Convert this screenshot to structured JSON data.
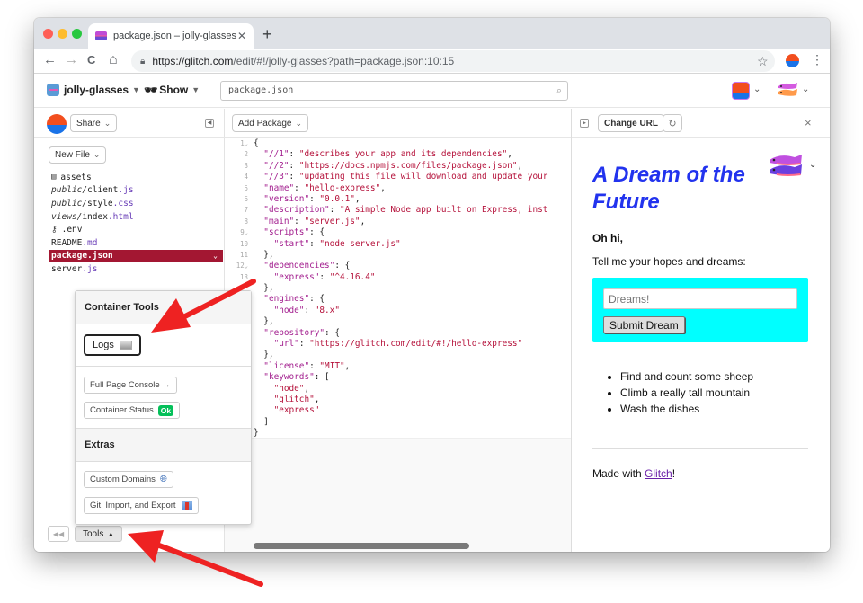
{
  "browser": {
    "tab_title": "package.json – jolly-glasses",
    "tab_close": "✕",
    "new_tab": "+",
    "url_host": "https://glitch.com",
    "url_path": "/edit/#!/jolly-glasses?path=package.json:10:15",
    "nav": {
      "back": "←",
      "forward": "→",
      "reload": "C",
      "home": "⌂"
    },
    "star": "☆",
    "menu": "⋮"
  },
  "header": {
    "project_name": "jolly-glasses",
    "show_label": "Show",
    "file_search_value": "package.json",
    "search_icon": "⌕"
  },
  "sidebar": {
    "share_label": "Share",
    "new_file_label": "New File",
    "files": [
      {
        "icon": "assets",
        "dir": "",
        "name": "assets",
        "ext": ""
      },
      {
        "dir": "public/",
        "name": "client",
        "ext": ".js"
      },
      {
        "dir": "public/",
        "name": "style",
        "ext": ".css"
      },
      {
        "dir": "views/",
        "name": "index",
        "ext": ".html"
      },
      {
        "icon": "key",
        "dir": "",
        "name": ".env",
        "ext": ""
      },
      {
        "dir": "",
        "name": "README",
        "ext": ".md"
      },
      {
        "dir": "",
        "name": "package.json",
        "ext": "",
        "active": true
      },
      {
        "dir": "",
        "name": "server",
        "ext": ".js"
      }
    ],
    "tools_label": "Tools",
    "tools_back_icon": "◀◀"
  },
  "tools_popover": {
    "container_tools_heading": "Container Tools",
    "logs_label": "Logs",
    "full_page_console_label": "Full Page Console →",
    "container_status_label": "Container Status",
    "container_status_badge": "Ok",
    "extras_heading": "Extras",
    "custom_domains_label": "Custom Domains",
    "git_import_export_label": "Git, Import, and Export",
    "status_color": "#05c05a"
  },
  "editor": {
    "add_package_label": "Add Package",
    "lines": [
      {
        "n": "1",
        "fold": true,
        "parts": [
          [
            "p",
            "{"
          ]
        ]
      },
      {
        "n": "2",
        "parts": [
          [
            "p",
            "  "
          ],
          [
            "k",
            "\"//1\""
          ],
          [
            "p",
            ": "
          ],
          [
            "s",
            "\"describes your app and its dependencies\""
          ],
          [
            "p",
            ","
          ]
        ]
      },
      {
        "n": "3",
        "parts": [
          [
            "p",
            "  "
          ],
          [
            "k",
            "\"//2\""
          ],
          [
            "p",
            ": "
          ],
          [
            "s",
            "\"https://docs.npmjs.com/files/package.json\""
          ],
          [
            "p",
            ","
          ]
        ]
      },
      {
        "n": "4",
        "parts": [
          [
            "p",
            "  "
          ],
          [
            "k",
            "\"//3\""
          ],
          [
            "p",
            ": "
          ],
          [
            "s",
            "\"updating this file will download and update your"
          ]
        ]
      },
      {
        "n": "5",
        "parts": [
          [
            "p",
            "  "
          ],
          [
            "k",
            "\"name\""
          ],
          [
            "p",
            ": "
          ],
          [
            "s",
            "\"hello-express\""
          ],
          [
            "p",
            ","
          ]
        ]
      },
      {
        "n": "6",
        "parts": [
          [
            "p",
            "  "
          ],
          [
            "k",
            "\"version\""
          ],
          [
            "p",
            ": "
          ],
          [
            "s",
            "\"0.0.1\""
          ],
          [
            "p",
            ","
          ]
        ]
      },
      {
        "n": "7",
        "parts": [
          [
            "p",
            "  "
          ],
          [
            "k",
            "\"description\""
          ],
          [
            "p",
            ": "
          ],
          [
            "s",
            "\"A simple Node app built on Express, inst"
          ]
        ]
      },
      {
        "n": "8",
        "parts": [
          [
            "p",
            "  "
          ],
          [
            "k",
            "\"main\""
          ],
          [
            "p",
            ": "
          ],
          [
            "s",
            "\"server.js\""
          ],
          [
            "p",
            ","
          ]
        ]
      },
      {
        "n": "9",
        "fold": true,
        "parts": [
          [
            "p",
            "  "
          ],
          [
            "k",
            "\"scripts\""
          ],
          [
            "p",
            ": {"
          ]
        ]
      },
      {
        "n": "10",
        "parts": [
          [
            "p",
            "    "
          ],
          [
            "k",
            "\"start\""
          ],
          [
            "p",
            ": "
          ],
          [
            "s",
            "\"node server.js\""
          ]
        ]
      },
      {
        "n": "11",
        "parts": [
          [
            "p",
            "  },"
          ]
        ]
      },
      {
        "n": "12",
        "fold": true,
        "parts": [
          [
            "p",
            "  "
          ],
          [
            "k",
            "\"dependencies\""
          ],
          [
            "p",
            ": {"
          ]
        ]
      },
      {
        "n": "13",
        "parts": [
          [
            "p",
            "    "
          ],
          [
            "k",
            "\"express\""
          ],
          [
            "p",
            ": "
          ],
          [
            "s",
            "\"^4.16.4\""
          ]
        ]
      },
      {
        "n": "",
        "parts": [
          [
            "p",
            "  },"
          ]
        ]
      },
      {
        "n": "",
        "parts": [
          [
            "p",
            "  "
          ],
          [
            "k",
            "\"engines\""
          ],
          [
            "p",
            ": {"
          ]
        ]
      },
      {
        "n": "",
        "parts": [
          [
            "p",
            "    "
          ],
          [
            "k",
            "\"node\""
          ],
          [
            "p",
            ": "
          ],
          [
            "s",
            "\"8.x\""
          ]
        ]
      },
      {
        "n": "",
        "parts": [
          [
            "p",
            "  },"
          ]
        ]
      },
      {
        "n": "",
        "parts": [
          [
            "p",
            "  "
          ],
          [
            "k",
            "\"repository\""
          ],
          [
            "p",
            ": {"
          ]
        ]
      },
      {
        "n": "",
        "parts": [
          [
            "p",
            "    "
          ],
          [
            "k",
            "\"url\""
          ],
          [
            "p",
            ": "
          ],
          [
            "s",
            "\"https://glitch.com/edit/#!/hello-express\""
          ]
        ]
      },
      {
        "n": "",
        "parts": [
          [
            "p",
            "  },"
          ]
        ]
      },
      {
        "n": "",
        "parts": [
          [
            "p",
            "  "
          ],
          [
            "k",
            "\"license\""
          ],
          [
            "p",
            ": "
          ],
          [
            "s",
            "\"MIT\""
          ],
          [
            "p",
            ","
          ]
        ]
      },
      {
        "n": "",
        "parts": [
          [
            "p",
            "  "
          ],
          [
            "k",
            "\"keywords\""
          ],
          [
            "p",
            ": ["
          ]
        ]
      },
      {
        "n": "",
        "parts": [
          [
            "p",
            "    "
          ],
          [
            "s",
            "\"node\""
          ],
          [
            "p",
            ","
          ]
        ]
      },
      {
        "n": "",
        "parts": [
          [
            "p",
            "    "
          ],
          [
            "s",
            "\"glitch\""
          ],
          [
            "p",
            ","
          ]
        ]
      },
      {
        "n": "",
        "parts": [
          [
            "p",
            "    "
          ],
          [
            "s",
            "\"express\""
          ]
        ]
      },
      {
        "n": "",
        "parts": [
          [
            "p",
            "  ]"
          ]
        ]
      },
      {
        "n": "",
        "parts": [
          [
            "p",
            "}"
          ]
        ]
      }
    ]
  },
  "preview": {
    "change_url_label": "Change URL",
    "reload_icon": "↻",
    "close_icon": "×",
    "title": "A Dream of the Future",
    "greeting": "Oh hi,",
    "prompt": "Tell me your hopes and dreams:",
    "input_placeholder": "Dreams!",
    "submit_label": "Submit Dream",
    "dreams": [
      "Find and count some sheep",
      "Climb a really tall mountain",
      "Wash the dishes"
    ],
    "made_with_prefix": "Made with ",
    "made_with_link": "Glitch",
    "made_with_suffix": "!",
    "title_color": "#2233ee",
    "form_color": "#00ffff"
  },
  "colors": {
    "active_file_bg": "#a31732",
    "annotation_arrow": "#ee2222"
  }
}
